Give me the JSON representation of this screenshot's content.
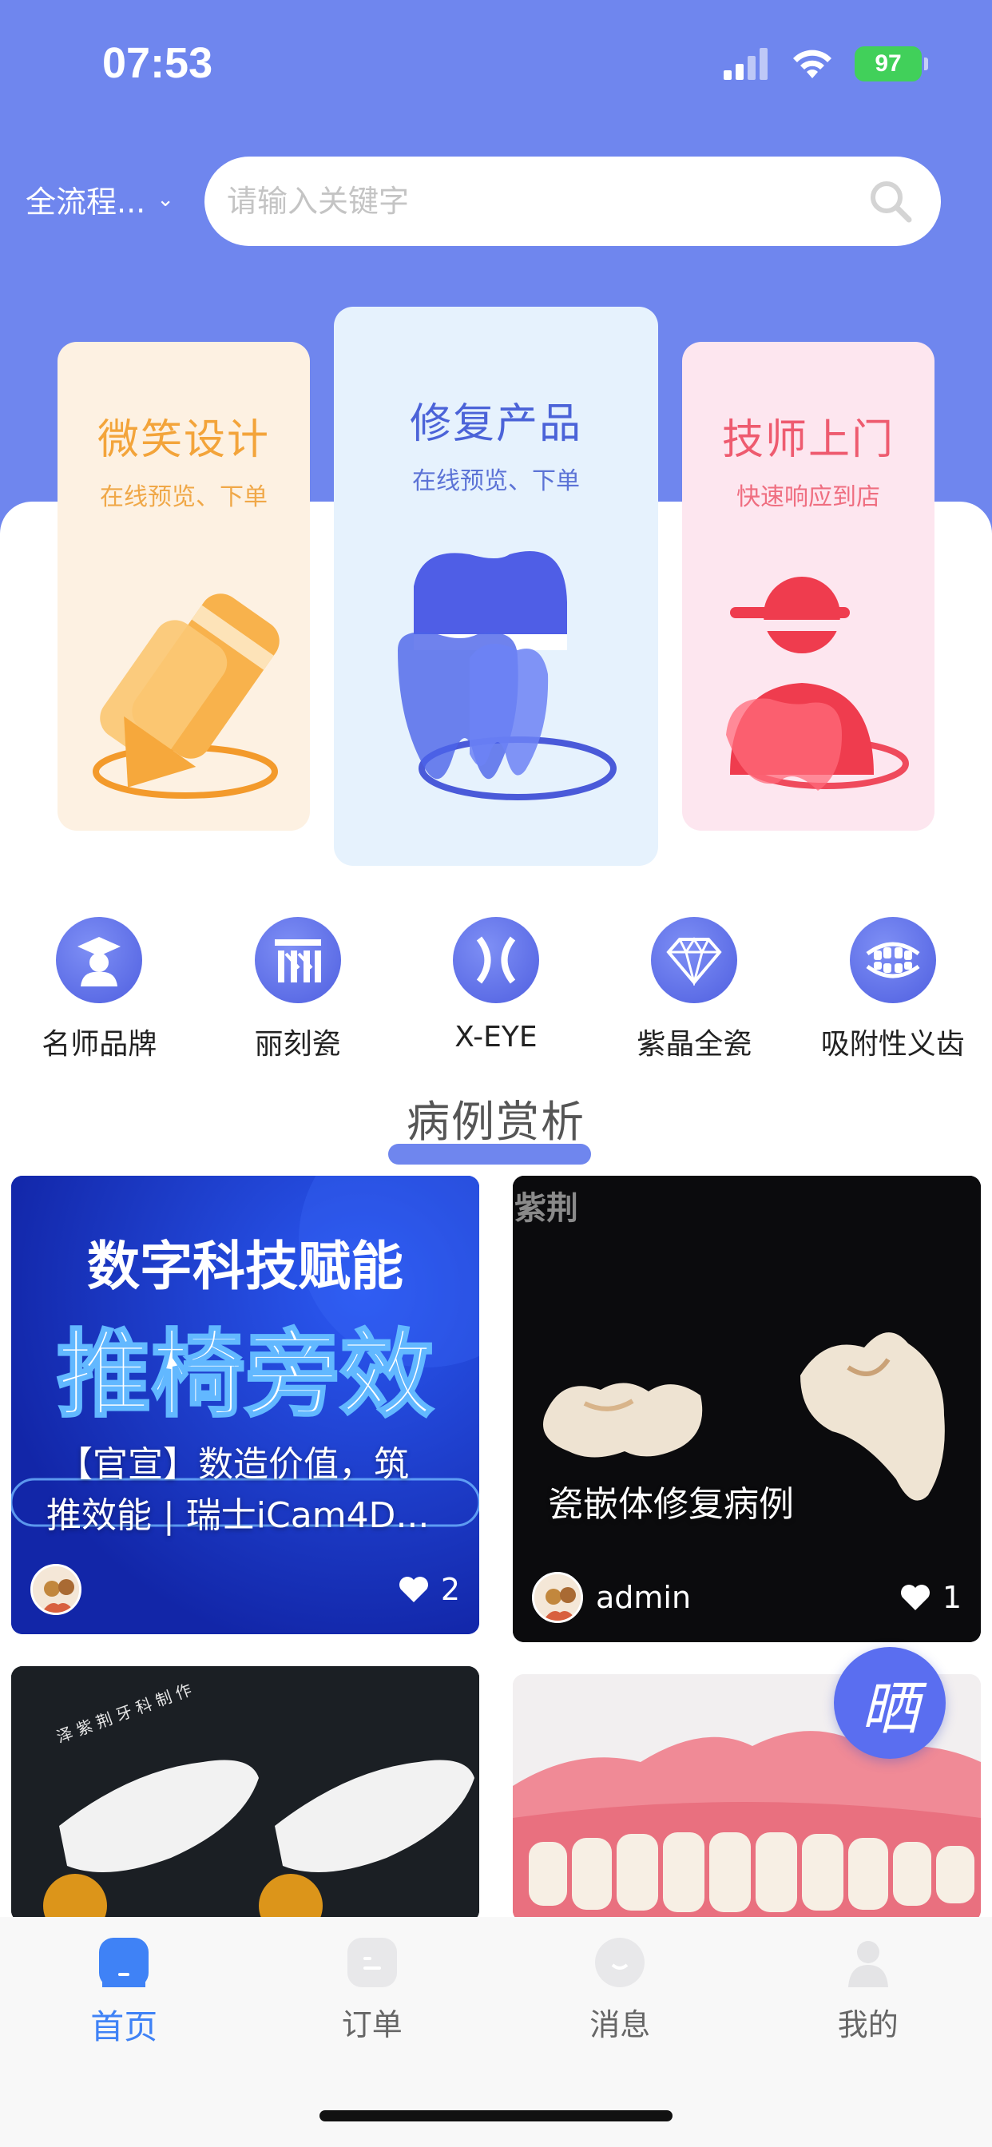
{
  "status_bar": {
    "time": "07:53",
    "battery": "97"
  },
  "header": {
    "scope_label": "全流程...",
    "search_placeholder": "请输入关键字"
  },
  "service_cards": [
    {
      "title": "微笑设计",
      "subtitle": "在线预览、下单"
    },
    {
      "title": "修复产品",
      "subtitle": "在线预览、下单"
    },
    {
      "title": "技师上门",
      "subtitle": "快速响应到店"
    }
  ],
  "categories": [
    {
      "label": "名师品牌",
      "icon": "teacher-icon"
    },
    {
      "label": "丽刻瓷",
      "icon": "like-ci-logo-icon"
    },
    {
      "label": "X-EYE",
      "icon": "x-eye-icon"
    },
    {
      "label": "紫晶全瓷",
      "icon": "diamond-icon"
    },
    {
      "label": "吸附性义齿",
      "icon": "denture-icon"
    }
  ],
  "section": {
    "title": "病例赏析"
  },
  "feed": [
    {
      "image_headline": "数字科技赋能",
      "image_headline2": "推椅旁效",
      "caption_line1": "【官宣】数造价值，筑",
      "caption_line2": "推效能 | 瑞士iCam4D...",
      "author": "",
      "likes": "2"
    },
    {
      "image_watermark": "紫荆",
      "caption_line1": "瓷嵌体修复病例",
      "author": "admin",
      "likes": "1"
    },
    {
      "image_watermark": "泽 紫 荆 牙 科 制 作"
    },
    {}
  ],
  "fab": {
    "label": "晒"
  },
  "tabbar": [
    {
      "label": "首页",
      "active": true
    },
    {
      "label": "订单"
    },
    {
      "label": "消息"
    },
    {
      "label": "我的"
    }
  ],
  "colors": {
    "hero_bg": "#6f86ee",
    "accent": "#3f82f6",
    "smile_card": "#fdf1e2",
    "repair_card": "#e6f2fd",
    "tech_card": "#fde6ef"
  }
}
